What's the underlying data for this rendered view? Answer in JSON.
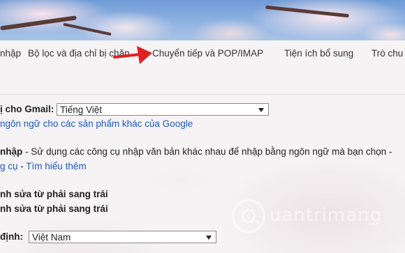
{
  "tabs": [
    {
      "label": "nhập"
    },
    {
      "label": "Bộ lọc và địa chỉ bị chặn"
    },
    {
      "label": "Chuyển tiếp và POP/IMAP"
    },
    {
      "label": "Tiện ích bổ sung"
    },
    {
      "label": "Trò chu"
    }
  ],
  "language": {
    "label": "ị cho Gmail:",
    "selected": "Tiếng Việt",
    "other_link": "ngôn ngữ cho các sản phẩm khác của Google"
  },
  "input_tools": {
    "label": "nhập",
    "description": " - Sử dụng các công cụ nhập văn bản khác nhau để nhập bằng ngôn ngữ mà bạn chọn -",
    "tools_link": "g cụ",
    "separator": " - ",
    "learn_more": "Tìm hiểu thêm"
  },
  "rtl": {
    "option_1": "nh sửa từ phải sang trái",
    "option_2": "nh sửa từ phải sang trái"
  },
  "country": {
    "label": "định:",
    "selected": "Việt Nam"
  },
  "arrow_color": "#e02020",
  "watermark": {
    "text": "uantrimang"
  }
}
